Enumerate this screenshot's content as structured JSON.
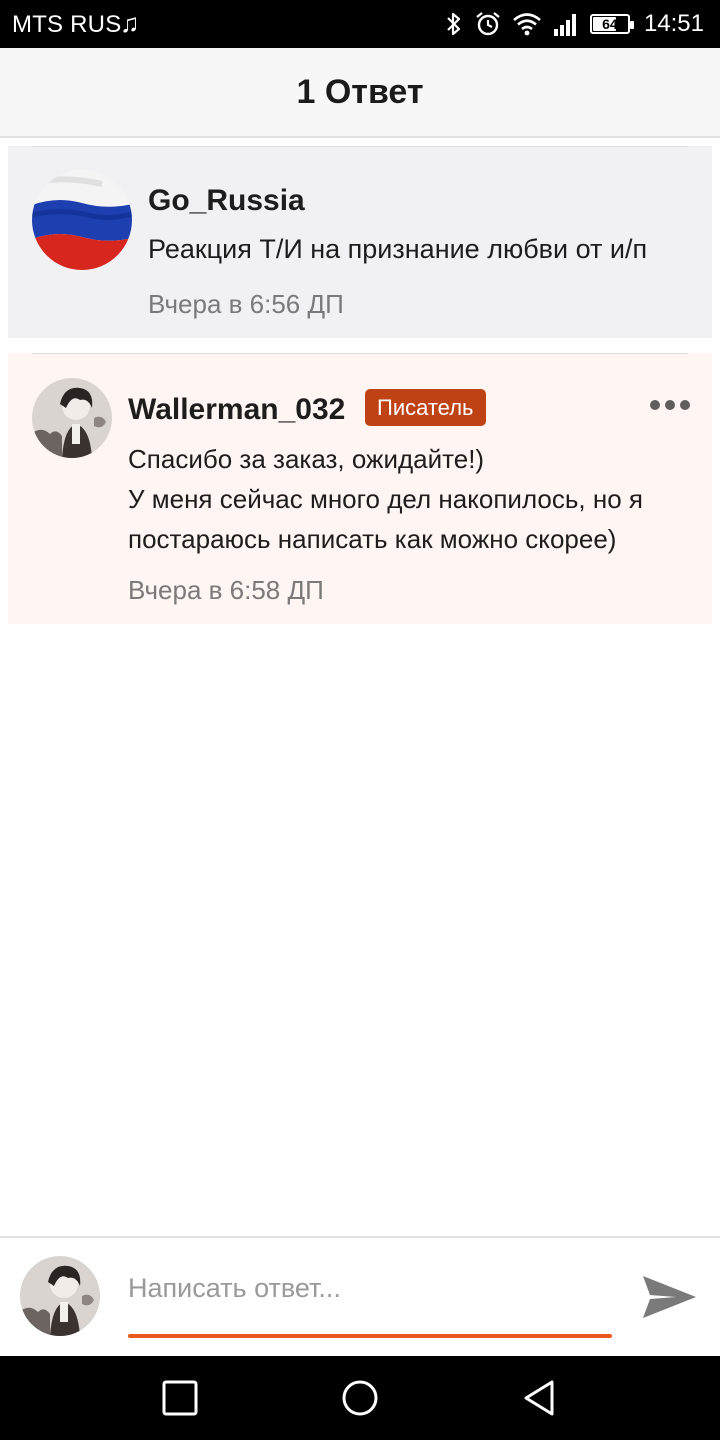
{
  "status_bar": {
    "carrier": "MTS RUS",
    "battery": "64",
    "time": "14:51",
    "icons": [
      "music-note-icon",
      "bluetooth-icon",
      "alarm-icon",
      "wifi-icon",
      "signal-icon",
      "battery-icon"
    ]
  },
  "header": {
    "title": "1 Ответ"
  },
  "parent_comment": {
    "author": "Go_Russia",
    "text": "Реакция Т/И на признание любви от и/п",
    "time": "Вчера в 6:56 ДП",
    "avatar": "russian-flag-avatar"
  },
  "reply": {
    "author": "Wallerman_032",
    "badge": "Писатель",
    "text_lines": [
      "Спасибо за заказ, ожидайте!)",
      "У меня сейчас много дел накопилось, но я",
      "постараюсь написать как можно скорее)"
    ],
    "time": "Вчера в 6:58 ДП",
    "badge_color": "#bf4215",
    "background_color": "#fff5f2"
  },
  "composer": {
    "placeholder": "Написать ответ...",
    "value": "",
    "accent_color": "#ea5a1e"
  },
  "navigation": {
    "buttons": [
      "recent-apps-icon",
      "home-icon",
      "back-icon"
    ]
  }
}
